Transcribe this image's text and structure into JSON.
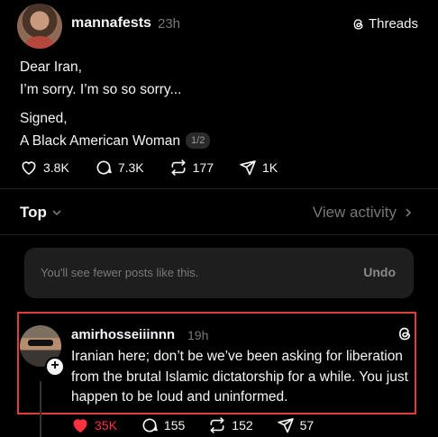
{
  "post": {
    "username": "mannafests",
    "timestamp": "23h",
    "threads_link": "Threads",
    "lines": [
      "Dear Iran,",
      "I’m sorry. I’m so so sorry...",
      "Signed,",
      "A Black American Woman"
    ],
    "page_badge": "1/2",
    "actions": {
      "likes": "3.8K",
      "replies": "7.3K",
      "reposts": "177",
      "shares": "1K"
    }
  },
  "sort": {
    "label": "Top",
    "view_activity": "View activity"
  },
  "notice": {
    "text": "You'll see fewer posts like this.",
    "undo": "Undo"
  },
  "reply": {
    "username": "amirhosseiiinnn",
    "timestamp": "19h",
    "text": "Iranian here; don’t be we’ve been asking for liberation from the brutal Islamic dictatorship for a while. You just happen to be loud and uninformed.",
    "actions": {
      "likes": "35K",
      "replies": "155",
      "reposts": "152",
      "shares": "57"
    },
    "liked": true
  },
  "colors": {
    "background": "#000000",
    "text": "#f3f5f7",
    "muted": "#777777",
    "like_red": "#ff3040",
    "highlight_border": "#e03c3c"
  },
  "icons": [
    "heart-icon",
    "comment-icon",
    "repost-icon",
    "share-icon",
    "threads-logo-icon",
    "chevron-down-icon",
    "chevron-right-icon",
    "plus-icon"
  ]
}
